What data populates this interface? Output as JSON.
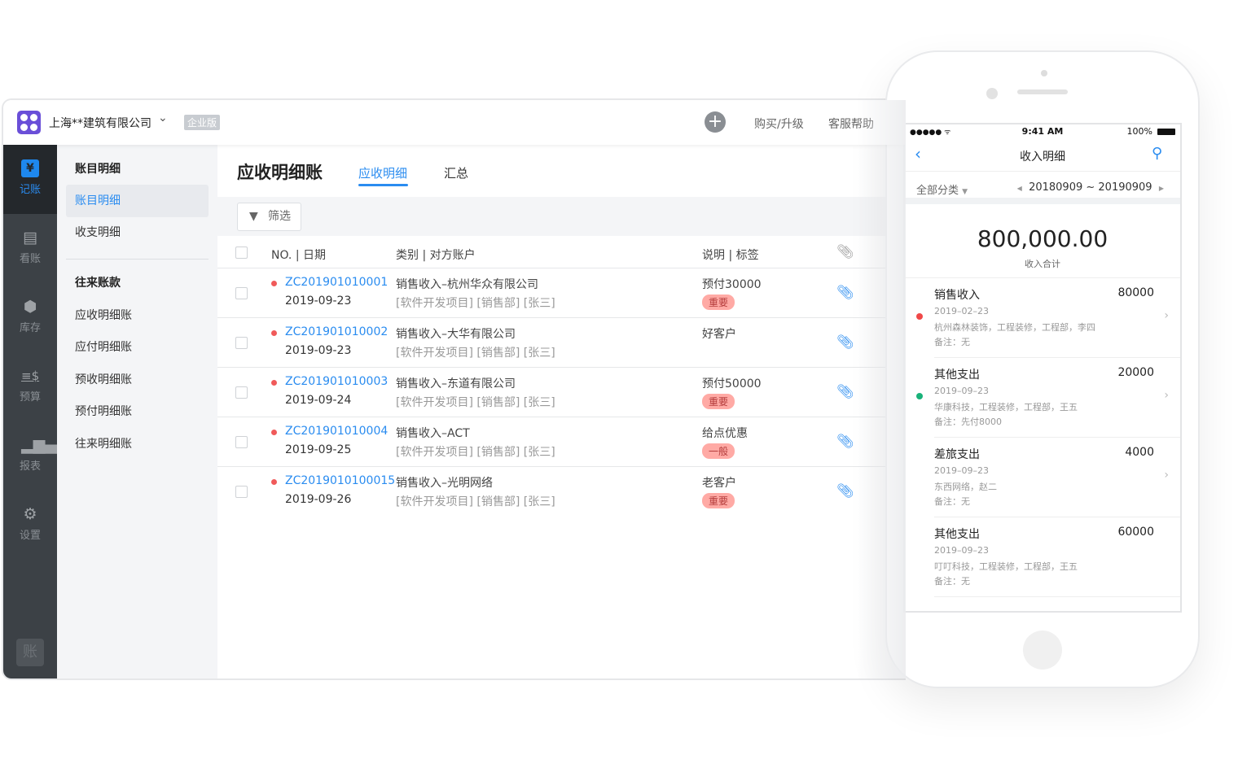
{
  "header": {
    "company": "上海**建筑有限公司",
    "edition": "企业版",
    "buy": "购买/升级",
    "help": "客服帮助"
  },
  "nav": [
    {
      "label": "记账",
      "icon": "yen-icon"
    },
    {
      "label": "看账",
      "icon": "calendar-icon"
    },
    {
      "label": "库存",
      "icon": "box-icon"
    },
    {
      "label": "预算",
      "icon": "budget-icon"
    },
    {
      "label": "报表",
      "icon": "bar-chart-icon"
    },
    {
      "label": "设置",
      "icon": "gear-icon"
    }
  ],
  "nav_logo": "账",
  "subnav": {
    "group1": "账目明细",
    "items1": [
      "账目明细",
      "收支明细"
    ],
    "group2": "往来账款",
    "items2": [
      "应收明细账",
      "应付明细账",
      "预收明细账",
      "预付明细账",
      "往来明细账"
    ]
  },
  "main": {
    "title": "应收明细账",
    "tabs": [
      "应收明细",
      "汇总"
    ],
    "filter": "筛选",
    "columns": [
      "NO. | 日期",
      "类别 | 对方账户",
      "说明 | 标签"
    ],
    "rows": [
      {
        "no": "ZC201901010001",
        "date": "2019-09-23",
        "category": "销售收入–杭州华众有限公司",
        "tags": "[软件开发项目] [销售部] [张三]",
        "desc": "预付30000",
        "badge": "重要"
      },
      {
        "no": "ZC201901010002",
        "date": "2019-09-23",
        "category": "销售收入–大华有限公司",
        "tags": "[软件开发项目] [销售部] [张三]",
        "desc": "好客户",
        "badge": null
      },
      {
        "no": "ZC201901010003",
        "date": "2019-09-24",
        "category": "销售收入–东道有限公司",
        "tags": "[软件开发项目] [销售部] [张三]",
        "desc": "预付50000",
        "badge": "重要"
      },
      {
        "no": "ZC201901010004",
        "date": "2019-09-25",
        "category": "销售收入–ACT",
        "tags": "[软件开发项目] [销售部] [张三]",
        "desc": "给点优惠",
        "badge": "一般"
      },
      {
        "no": "ZC2019010100015",
        "date": "2019-09-26",
        "category": "销售收入–光明网络",
        "tags": "[软件开发项目] [销售部] [张三]",
        "desc": "老客户",
        "badge": "重要"
      }
    ]
  },
  "phone": {
    "time": "9:41 AM",
    "battery": "100%",
    "signal": "●●●●● ᯤ",
    "title": "收入明细",
    "category": "全部分类",
    "range": "20180909 ~ 20190909",
    "total": "800,000.00",
    "total_label": "收入合计",
    "items": [
      {
        "cat": "销售收入",
        "amount": "80000",
        "date": "2019–02–23",
        "parties": "杭州森林装饰，工程装修，工程部，李四",
        "note": "备注：无",
        "dot": "#f04848"
      },
      {
        "cat": "其他支出",
        "amount": "20000",
        "date": "2019–09–23",
        "parties": "华康科技，工程装修，工程部，王五",
        "note": "备注：先付8000",
        "dot": "#19b27a"
      },
      {
        "cat": "差旅支出",
        "amount": "4000",
        "date": "2019–09–23",
        "parties": "东西网络，赵二",
        "note": "备注：无",
        "dot": null
      },
      {
        "cat": "其他支出",
        "amount": "60000",
        "date": "2019–09–23",
        "parties": "叮叮科技，工程装修，工程部，王五",
        "note": "备注：无",
        "dot": null
      }
    ]
  },
  "colors": {
    "accent": "#2a8cf0",
    "logo": "#6a4fd8",
    "sidebar": "#3c4146",
    "danger": "#f05a5a"
  }
}
